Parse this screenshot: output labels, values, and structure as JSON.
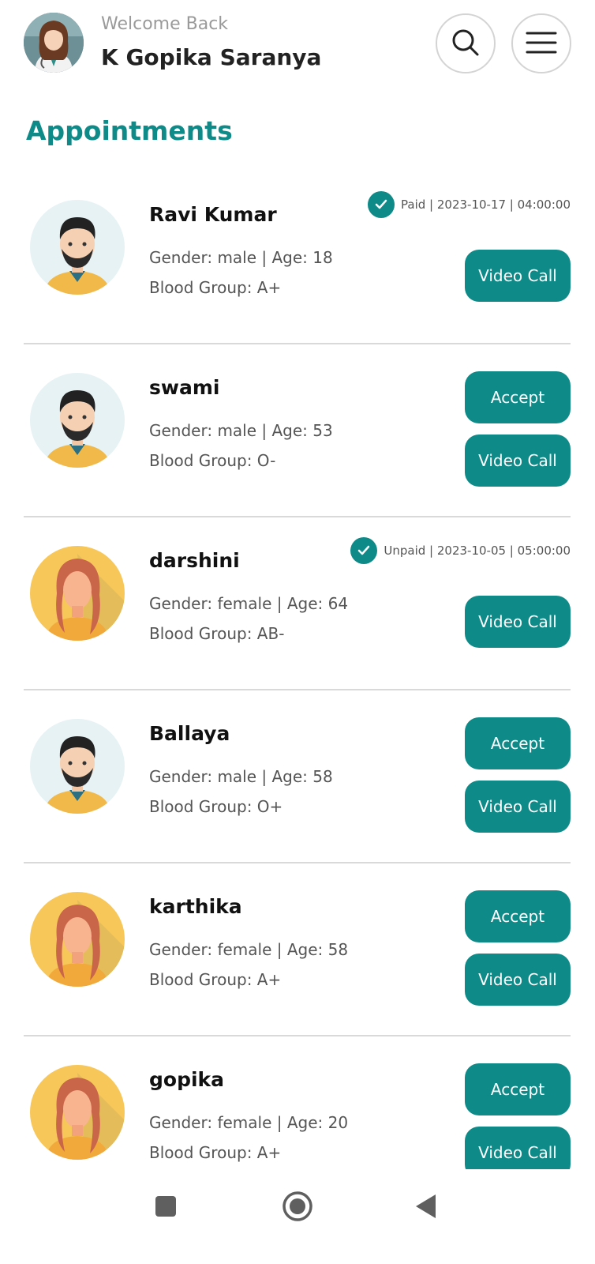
{
  "header": {
    "welcome": "Welcome Back",
    "username": "K Gopika Saranya"
  },
  "section_title": "Appointments",
  "appointments": [
    {
      "name": "Ravi Kumar",
      "gender_age": "Gender: male | Age: 18",
      "blood": "Blood Group: A+",
      "status": "Paid | 2023-10-17 | 04:00:00",
      "video_label": "Video Call"
    },
    {
      "name": "swami",
      "gender_age": "Gender: male | Age: 53",
      "blood": "Blood Group: O-",
      "accept_label": "Accept",
      "video_label": "Video Call"
    },
    {
      "name": "darshini",
      "gender_age": "Gender: female | Age: 64",
      "blood": "Blood Group: AB-",
      "status": "Unpaid | 2023-10-05 | 05:00:00",
      "video_label": "Video Call"
    },
    {
      "name": "Ballaya",
      "gender_age": "Gender: male | Age: 58",
      "blood": "Blood Group: O+",
      "accept_label": "Accept",
      "video_label": "Video Call"
    },
    {
      "name": "karthika",
      "gender_age": "Gender: female | Age: 58",
      "blood": "Blood Group: A+",
      "accept_label": "Accept",
      "video_label": "Video Call"
    },
    {
      "name": "gopika",
      "gender_age": "Gender: female | Age: 20",
      "blood": "Blood Group: A+",
      "accept_label": "Accept",
      "video_label": "Video Call"
    }
  ],
  "icons": {
    "search": "search-icon",
    "menu": "menu-icon",
    "check": "check-icon",
    "recents": "recents-square-icon",
    "home": "home-circle-icon",
    "back": "back-triangle-icon"
  },
  "colors": {
    "accent": "#0e8a88",
    "female_avatar_bg": "#f7c75a",
    "male_avatar_bg": "#e6f2f4"
  }
}
